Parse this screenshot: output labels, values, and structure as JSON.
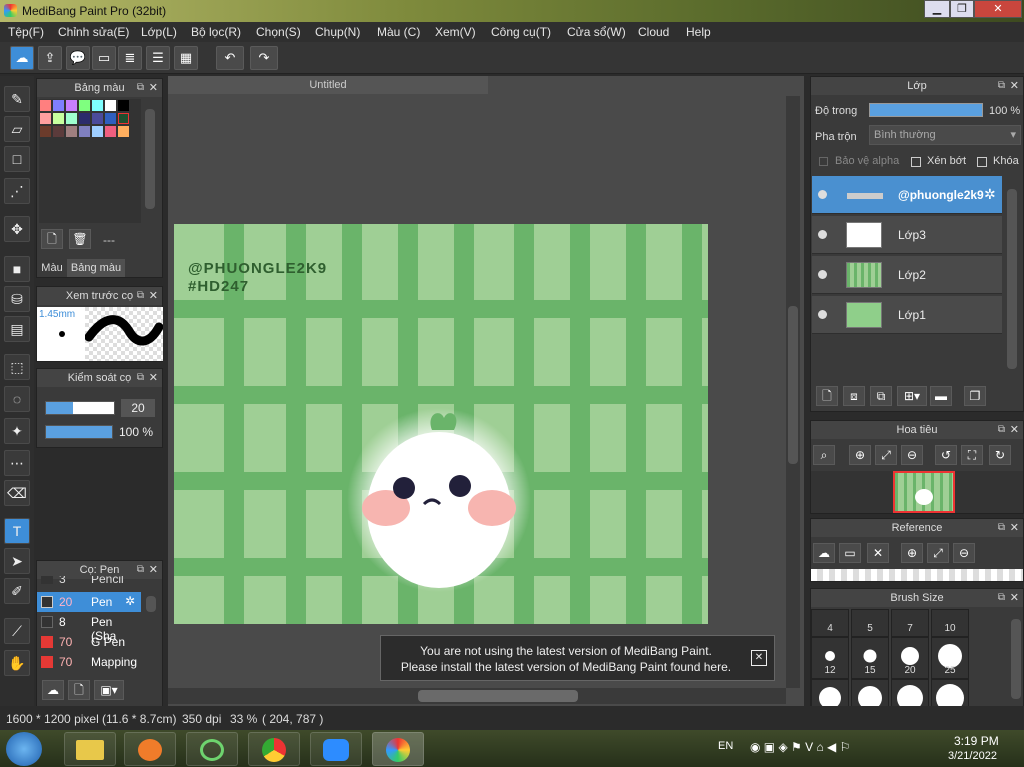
{
  "window": {
    "title": "MediBang Paint Pro (32bit)",
    "minimize": "▁",
    "restore": "❐",
    "close": "✕"
  },
  "menu": [
    "Tệp(F)",
    "Chỉnh sửa(E)",
    "Lớp(L)",
    "Bộ lọc(R)",
    "Chọn(S)",
    "Chụp(N)",
    "Màu (C)",
    "Xem(V)",
    "Công cụ(T)",
    "Cửa sổ(W)",
    "Cloud",
    "Help"
  ],
  "palette": {
    "title": "Bảng màu",
    "tab_color": "Màu",
    "tab_palette": "Bảng màu",
    "counter": "---"
  },
  "brush_preview": {
    "title": "Xem trước cọ",
    "size": "1.45mm"
  },
  "brush_control": {
    "title": "Kiểm soát cọ",
    "size": "20",
    "opacity": "100 %"
  },
  "brushes": {
    "title": "Cọ: Pen",
    "items": [
      {
        "size": "3",
        "name": "Pencil",
        "color": "#333333"
      },
      {
        "size": "20",
        "name": "Pen",
        "color": "#333333",
        "selected": true
      },
      {
        "size": "8",
        "name": "Pen (Sha",
        "color": "#333333"
      },
      {
        "size": "70",
        "name": "G Pen",
        "color": "#e53935"
      },
      {
        "size": "70",
        "name": "Mapping",
        "color": "#e53935"
      }
    ]
  },
  "canvas": {
    "tab": "Untitled",
    "watermark_1": "@PHUONGLE2K9",
    "watermark_2": "#HD247"
  },
  "notice": {
    "line1": "You are not using the latest version of MediBang Paint.",
    "line2": "Please install the latest version of MediBang Paint found here.",
    "close": "✕"
  },
  "layers": {
    "title": "Lớp",
    "opacity_label": "Độ trong",
    "opacity_value": "100 %",
    "blend_label": "Pha trộn",
    "blend_value": "Bình thường",
    "protect_alpha": "Bảo vệ alpha",
    "clip": "Xén bớt",
    "lock": "Khóa",
    "items": [
      "@phuongle2k9",
      "Lớp3",
      "Lớp2",
      "Lớp1"
    ]
  },
  "navigator": {
    "title": "Hoa tiêu"
  },
  "reference": {
    "title": "Reference"
  },
  "brush_size": {
    "title": "Brush Size",
    "row1": [
      "4",
      "5",
      "7",
      "10"
    ],
    "row2": [
      "12",
      "15",
      "20",
      "25"
    ]
  },
  "status": {
    "pixels": "1600 * 1200 pixel",
    "cm": "(11.6 * 8.7cm)",
    "dpi": "350 dpi",
    "zoom": "33 %",
    "coords": "( 204, 787 )"
  },
  "taskbar": {
    "lang": "EN",
    "time": "3:19 PM",
    "date": "3/21/2022"
  }
}
